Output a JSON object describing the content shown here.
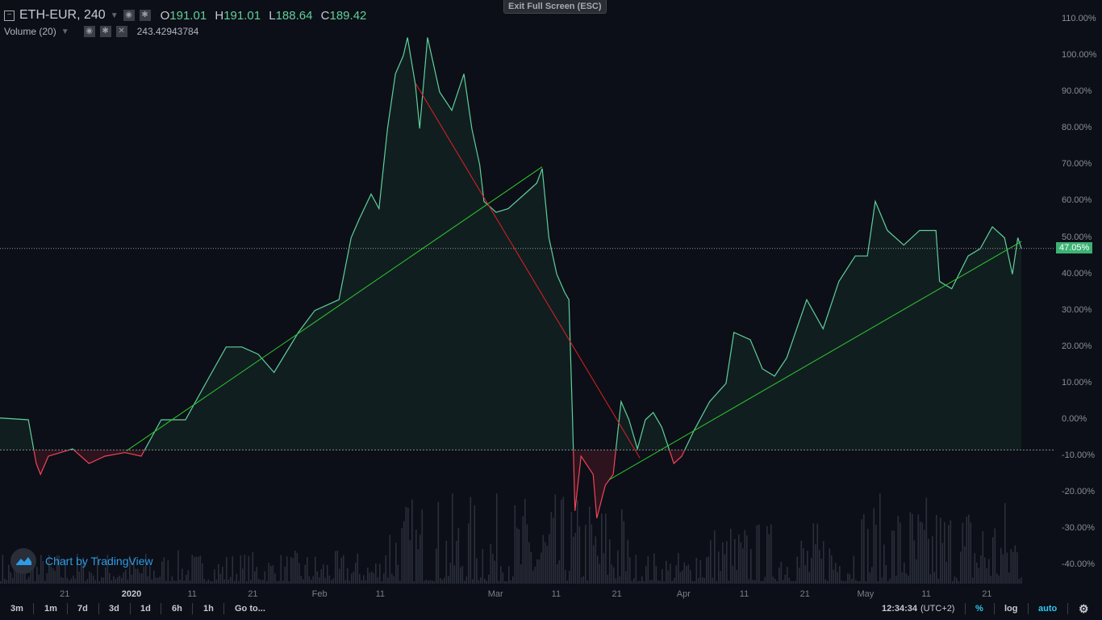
{
  "header": {
    "symbol": "ETH-EUR, 240",
    "o_label": "O",
    "o": "191.01",
    "h_label": "H",
    "h": "191.01",
    "l_label": "L",
    "l": "188.64",
    "c_label": "C",
    "c": "189.42",
    "volume_label": "Volume (20)",
    "volume_value": "243.42943784"
  },
  "exit_fullscreen": "Exit Full Screen (ESC)",
  "price_tag": "47.05%",
  "watermark": "Chart by TradingView",
  "bottom": {
    "ranges": [
      "3m",
      "1m",
      "7d",
      "3d",
      "1d",
      "6h",
      "1h"
    ],
    "goto": "Go to...",
    "time": "12:34:34",
    "tz": "(UTC+2)",
    "percent": "%",
    "log": "log",
    "auto": "auto"
  },
  "colors": {
    "up": "#5fcf9a",
    "down": "#f0445a",
    "trend_up": "#2ecc2e",
    "trend_down": "#e02020",
    "accent": "#2e9be6"
  },
  "chart_data": {
    "type": "area",
    "yaxis": {
      "ticks": [
        "110.00%",
        "100.00%",
        "90.00%",
        "80.00%",
        "70.00%",
        "60.00%",
        "50.00%",
        "40.00%",
        "30.00%",
        "20.00%",
        "10.00%",
        "0.00%",
        "-10.00%",
        "-20.00%",
        "-30.00%",
        "-40.00%"
      ],
      "values": [
        110,
        100,
        90,
        80,
        70,
        60,
        50,
        40,
        30,
        20,
        10,
        0,
        -10,
        -20,
        -30,
        -40
      ]
    },
    "xaxis": {
      "ticks": [
        "21",
        "2020",
        "11",
        "21",
        "Feb",
        "11",
        "Mar",
        "11",
        "21",
        "Apr",
        "11",
        "21",
        "May",
        "11",
        "21"
      ],
      "days": [
        -11,
        0,
        10,
        20,
        31,
        41,
        60,
        70,
        80,
        91,
        101,
        111,
        121,
        131,
        141
      ]
    },
    "baseline_pct": -8.3,
    "last_pct": 47.05,
    "series": {
      "name": "ETH-EUR % change",
      "days": [
        -21.7,
        -17,
        -15.7,
        -15,
        -13.7,
        -9.7,
        -7,
        -4.4,
        -1.1,
        1.6,
        4.9,
        8.9,
        12.9,
        15.6,
        18.2,
        20.9,
        23.5,
        27.5,
        30.2,
        34.2,
        36.2,
        37.5,
        39.5,
        40.8,
        42.2,
        43.5,
        44.8,
        45.5,
        46.8,
        47.5,
        48.8,
        50.8,
        52.8,
        54.8,
        56.1,
        57.4,
        58.1,
        60.1,
        62.1,
        64.8,
        66.8,
        67.7,
        68.8,
        70.1,
        71.4,
        72.1,
        72.7,
        73.1,
        74.1,
        76.1,
        76.7,
        78.1,
        79.4,
        80.7,
        82,
        83.4,
        84.7,
        86,
        87.4,
        89.4,
        90.7,
        92.7,
        95.3,
        98,
        99.3,
        102,
        104,
        106,
        108,
        111.3,
        114,
        116.6,
        119.3,
        121.3,
        122.6,
        124.6,
        127.3,
        129.9,
        132.6,
        133.2,
        135.2,
        137.9,
        139.9,
        141.9,
        143.9,
        145.2,
        146.1,
        146.7
      ],
      "pct": [
        0.5,
        0,
        -12,
        -15,
        -10,
        -8,
        -12,
        -10,
        -9,
        -10,
        0,
        0,
        12,
        20,
        20,
        18,
        13,
        24,
        30,
        33,
        50,
        55,
        62,
        58,
        80,
        95,
        100,
        105,
        92,
        80,
        105,
        90,
        85,
        95,
        80,
        70,
        60,
        57,
        58,
        62,
        65,
        69,
        50,
        40,
        35,
        33,
        0,
        -25,
        -10,
        -15,
        -27,
        -18,
        -15,
        5,
        0,
        -8,
        0,
        2,
        -2,
        -12,
        -10,
        -3,
        5,
        10,
        24,
        22,
        14,
        12,
        17,
        33,
        25,
        38,
        45,
        45,
        60,
        52,
        48,
        52,
        52,
        38,
        36,
        45,
        47,
        53,
        50,
        40,
        50,
        47
      ]
    },
    "trendlines": [
      {
        "from": [
          -0.8,
          -8.5
        ],
        "to": [
          67.7,
          69.5
        ],
        "color": "up"
      },
      {
        "from": [
          46.8,
          92.5
        ],
        "to": [
          83.8,
          -10.5
        ],
        "color": "down"
      },
      {
        "from": [
          78.7,
          -16.5
        ],
        "to": [
          146.7,
          49
        ]
      }
    ]
  }
}
